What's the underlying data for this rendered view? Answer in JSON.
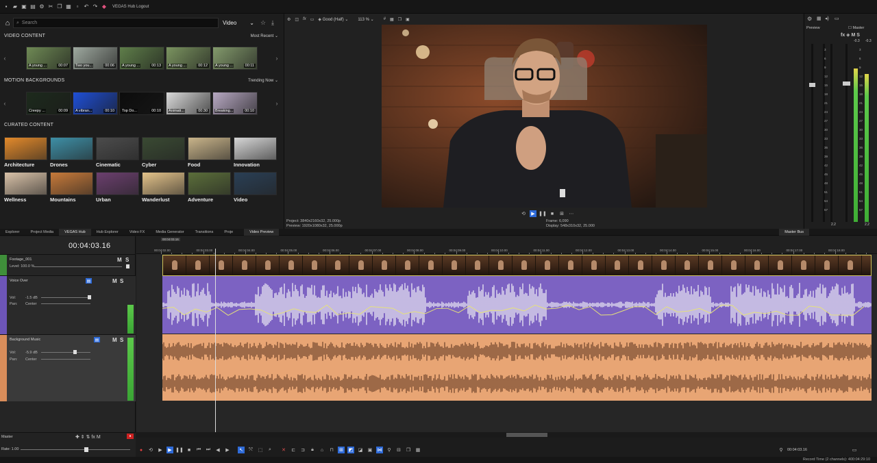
{
  "titlebar": {
    "title": "VEGAS Hub Logout"
  },
  "hub": {
    "search_placeholder": "Search",
    "category": "Video",
    "sections": {
      "video_content": {
        "title": "VIDEO CONTENT",
        "sort": "Most Recent",
        "items": [
          {
            "label": "A young ...",
            "duration": "00:07",
            "color": "#6f8a55"
          },
          {
            "label": "Two you...",
            "duration": "00:06",
            "color": "#9fa9a0"
          },
          {
            "label": "A young ...",
            "duration": "00:13",
            "color": "#5f7e4a"
          },
          {
            "label": "A young ...",
            "duration": "00:12",
            "color": "#7b9460"
          },
          {
            "label": "A young ...",
            "duration": "00:11",
            "color": "#839a6c"
          }
        ]
      },
      "motion_backgrounds": {
        "title": "MOTION BACKGROUNDS",
        "sort": "Trending Now",
        "items": [
          {
            "label": "Creepy ...",
            "duration": "00:09",
            "color": "#1d2a1c"
          },
          {
            "label": "A vibran...",
            "duration": "00:10",
            "color": "#1f4fd6"
          },
          {
            "label": "Top Do...",
            "duration": "00:10",
            "color": "#0c0c0c"
          },
          {
            "label": "Animati...",
            "duration": "00:30",
            "color": "#d9d9d9"
          },
          {
            "label": "Breaking...",
            "duration": "00:10",
            "color": "#b7a8c2"
          }
        ]
      },
      "curated_content": {
        "title": "CURATED CONTENT",
        "items": [
          {
            "label": "Architecture",
            "color": "#e38a2b"
          },
          {
            "label": "Drones",
            "color": "#3e8fa6"
          },
          {
            "label": "Cinematic",
            "color": "#4c4c4c"
          },
          {
            "label": "Cyber",
            "color": "#3a4a33"
          },
          {
            "label": "Food",
            "color": "#c9b48a"
          },
          {
            "label": "Innovation",
            "color": "#d6d6d6"
          },
          {
            "label": "Wellness",
            "color": "#d9c2a8"
          },
          {
            "label": "Mountains",
            "color": "#c77a3a"
          },
          {
            "label": "Urban",
            "color": "#6b3f6e"
          },
          {
            "label": "Wanderlust",
            "color": "#e4c38a"
          },
          {
            "label": "Adventure",
            "color": "#5b6e3a"
          },
          {
            "label": "Video",
            "color": "#2a3f55"
          }
        ]
      }
    }
  },
  "preview": {
    "quality": "Good (Half)",
    "zoom": "113 %",
    "project": "Project:   3840x2160x32, 25.000p",
    "preview_res": "Preview:   1920x1080x32, 25.000p",
    "frame": "Frame:      6,090",
    "display": "Display:   548x310x32, 25.000",
    "panel_label": "Preview",
    "master_label": "Master"
  },
  "tabs": [
    {
      "label": "Explorer"
    },
    {
      "label": "Project Media"
    },
    {
      "label": "VEGAS Hub"
    },
    {
      "label": "Hub Explorer"
    },
    {
      "label": "Video FX"
    },
    {
      "label": "Media Generator"
    },
    {
      "label": "Transitions"
    },
    {
      "label": "Proje"
    },
    {
      "label": "Video Preview"
    },
    {
      "label": "Master Bus"
    }
  ],
  "timeline": {
    "timecode": "00:04:03.16",
    "ruler_start_label": "00:04:03.16",
    "ruler_labels": [
      "00:04:02.00",
      "00:04:03.00",
      "00:04:04.00",
      "00:04:05.00",
      "00:04:06.00",
      "00:04:07.00",
      "00:04:08.00",
      "00:04:09.00",
      "00:04:10.00",
      "00:04:11.00",
      "00:04:12.00",
      "00:04:13.00",
      "00:04:14.00",
      "00:04:15.00",
      "00:04:16.00",
      "00:04:17.00",
      "00:04:18.00"
    ],
    "tracks": {
      "footage": {
        "name": "Footage_001",
        "level": "Level: 100.0 %"
      },
      "voice": {
        "name": "Voice Over",
        "vol_label": "Vol:",
        "vol": "-1.5 dB",
        "pan_label": "Pan:",
        "pan": "Center"
      },
      "music": {
        "name": "Background Music",
        "vol_label": "Vol:",
        "vol": "-5.9 dB",
        "pan_label": "Pan:",
        "pan": "Center"
      }
    },
    "master": {
      "name": "Master",
      "rate": "Rate: 1.00"
    },
    "cursor_time": "00:04:03.16",
    "record_time": "Record Time (2 channels): 400:04:29:10"
  },
  "meters": {
    "scale": [
      "3",
      "6",
      "9",
      "12",
      "15",
      "18",
      "21",
      "24",
      "27",
      "30",
      "33",
      "36",
      "39",
      "42",
      "45",
      "48",
      "51",
      "54",
      "57"
    ],
    "peak_left": "-0.3",
    "peak_right": "-0.3",
    "bottom_left": "2.2",
    "bottom_right": "2.2"
  },
  "colors": {
    "voice_clip": "#7c62c2",
    "music_clip": "#e8a574",
    "accent": "#2f6bd8",
    "meter_green": "#5cc94a"
  }
}
